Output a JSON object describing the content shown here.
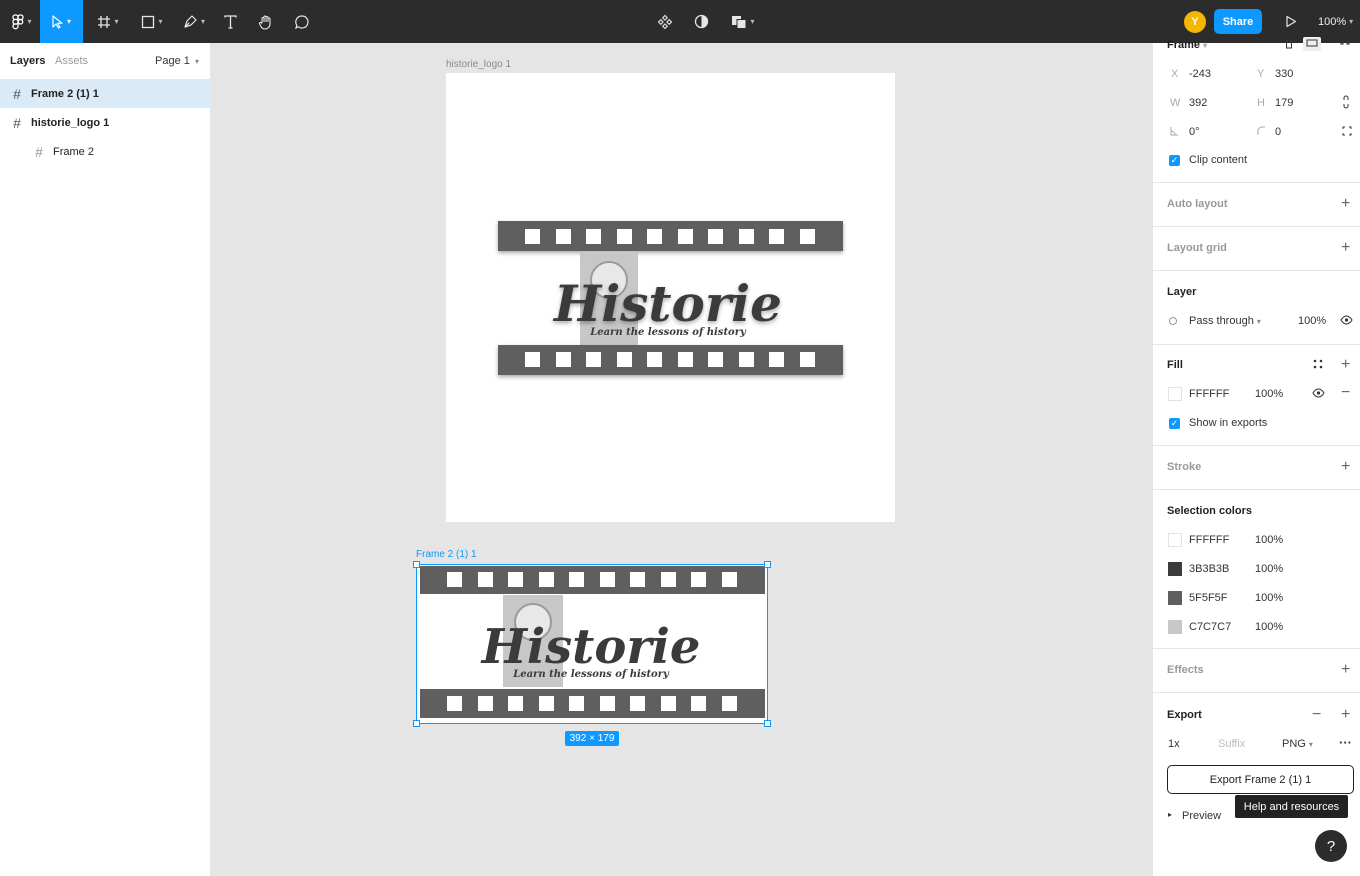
{
  "toolbar": {
    "share_label": "Share",
    "avatar_initial": "Y",
    "zoom_label": "100%",
    "zoom_percent": 100
  },
  "left_panel": {
    "tab_layers": "Layers",
    "tab_assets": "Assets",
    "page_label": "Page 1",
    "layers": [
      {
        "label": "Frame 2 (1) 1",
        "selected": true
      },
      {
        "label": "historie_logo 1",
        "selected": false
      },
      {
        "label": "Frame 2",
        "selected": false
      }
    ]
  },
  "canvas": {
    "big_frame_label": "historie_logo 1",
    "selected_frame_label": "Frame 2 (1) 1",
    "size_badge": "392 × 179",
    "logo_title": "Historie",
    "logo_tagline": "Learn the lessons of history"
  },
  "right_panel": {
    "frame_label": "Frame",
    "x_label": "X",
    "x_value": "-243",
    "y_label": "Y",
    "y_value": "330",
    "w_label": "W",
    "w_value": "392",
    "h_label": "H",
    "h_value": "179",
    "rotation_value": "0°",
    "radius_value": "0",
    "clip_content_label": "Clip content",
    "auto_layout_label": "Auto layout",
    "layout_grid_label": "Layout grid",
    "layer_heading": "Layer",
    "blend_mode": "Pass through",
    "layer_opacity": "100%",
    "fill_heading": "Fill",
    "fill_hex": "FFFFFF",
    "fill_opacity": "100%",
    "show_in_exports_label": "Show in exports",
    "stroke_label": "Stroke",
    "selection_colors_heading": "Selection colors",
    "selection_colors": [
      {
        "hex": "FFFFFF",
        "opacity": "100%",
        "color": "#ffffff"
      },
      {
        "hex": "3B3B3B",
        "opacity": "100%",
        "color": "#3b3b3b"
      },
      {
        "hex": "5F5F5F",
        "opacity": "100%",
        "color": "#5f5f5f"
      },
      {
        "hex": "C7C7C7",
        "opacity": "100%",
        "color": "#c7c7c7"
      }
    ],
    "effects_label": "Effects",
    "export_heading": "Export",
    "export_scale": "1x",
    "export_suffix_placeholder": "Suffix",
    "export_format": "PNG",
    "export_button_label": "Export Frame 2 (1) 1",
    "preview_label": "Preview",
    "tooltip_label": "Help and resources",
    "help_label": "?"
  },
  "colors": {
    "accent": "#0d99ff",
    "toolbar_bg": "#2c2c2c",
    "canvas_bg": "#e5e5e5",
    "film_strip": "#5f5f5f"
  }
}
